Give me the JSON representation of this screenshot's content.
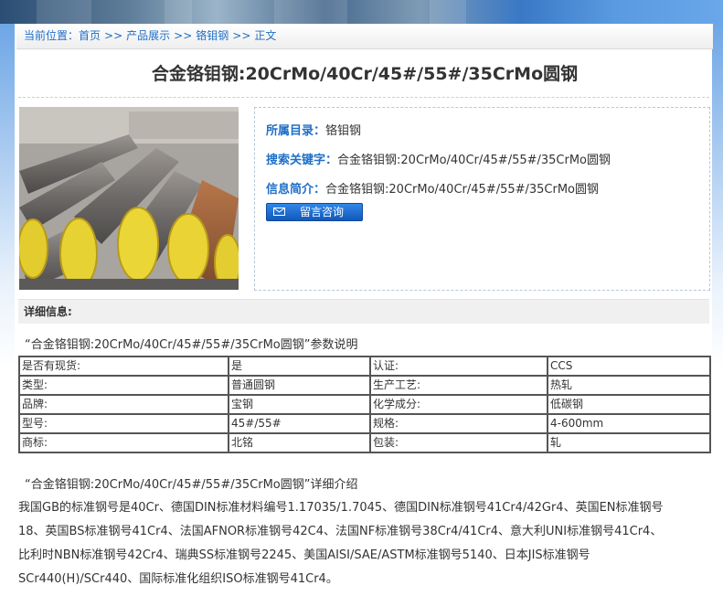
{
  "breadcrumb": {
    "prefix": "当前位置：",
    "items": [
      "首页",
      "产品展示",
      "铬钼钢",
      "正文"
    ],
    "separator": ">>"
  },
  "page_title": "合金铬钼钢:20CrMo/40Cr/45#/55#/35CrMo圆钢",
  "info": {
    "category_label": "所属目录：",
    "category_value": "铬钼钢",
    "keywords_label": "搜索关键字：",
    "keywords_value": "合金铬钼钢:20CrMo/40Cr/45#/55#/35CrMo圆钢",
    "summary_label": "信息简介：",
    "summary_value": "合金铬钼钢:20CrMo/40Cr/45#/55#/35CrMo圆钢",
    "consult_button": "留言咨询"
  },
  "detail": {
    "header": "详细信息:",
    "param_title": "“合金铬钼钢:20CrMo/40Cr/45#/55#/35CrMo圆钢”参数说明",
    "table": [
      [
        "是否有现货:",
        "是",
        "认证:",
        "CCS"
      ],
      [
        "类型:",
        "普通圆钢",
        "生产工艺:",
        "热轧"
      ],
      [
        "品牌:",
        "宝钢",
        "化学成分:",
        "低碳钢"
      ],
      [
        "型号:",
        "45#/55#",
        "规格:",
        "4-600mm"
      ],
      [
        "商标:",
        "北铭",
        "包装:",
        "轧"
      ]
    ],
    "intro_title": "“合金铬钼钢:20CrMo/40Cr/45#/55#/35CrMo圆钢”详细介绍",
    "intro_lines": [
      "我国GB的标准钢号是40Cr、德国DIN标准材料编号1.17035/1.7045、德国DIN标准钢号41Cr4/42Gr4、英国EN标准钢号",
      "18、英国BS标准钢号41Cr4、法国AFNOR标准钢号42C4、法国NF标准钢号38Cr4/41Cr4、意大利UNI标准钢号41Cr4、",
      "比利时NBN标准钢号42Cr4、瑞典SS标准钢号2245、美国AISI/SAE/ASTM标准钢号5140、日本JIS标准钢号",
      "SCr440(H)/SCr440、国际标准化组织ISO标准钢号41Cr4。"
    ]
  },
  "colors": {
    "link_blue": "#1f6fc7",
    "button_blue": "#1a66cc",
    "text": "#333333"
  },
  "icons": {
    "consult": "envelope-icon"
  }
}
